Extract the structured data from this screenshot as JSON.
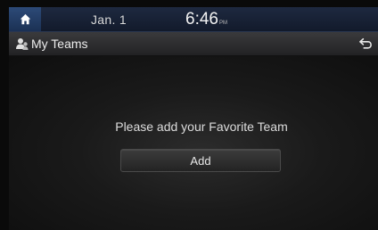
{
  "status_bar": {
    "date": "Jan.  1",
    "time": "6:46",
    "ampm": "PM"
  },
  "header": {
    "title": "My Teams",
    "icon": "teams-icon",
    "back_icon": "back-arrow-icon"
  },
  "main": {
    "message": "Please add your Favorite Team",
    "add_button": "Add"
  },
  "colors": {
    "status_bar": "#1e2940",
    "home_button": "#2d4a78",
    "title_bar": "#3a3a3c"
  }
}
